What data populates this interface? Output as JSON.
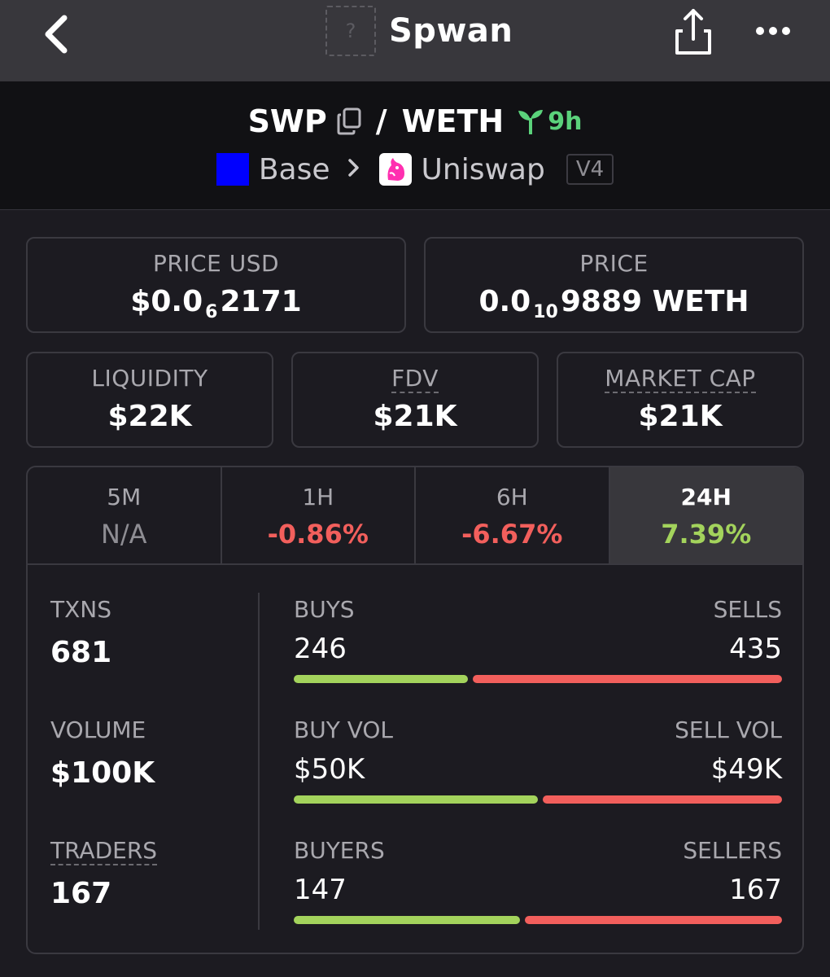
{
  "nav": {
    "title": "Spwan",
    "token_placeholder": "?",
    "icons": {
      "back": "chevron-left-icon",
      "share": "share-icon",
      "more": "more-horizontal-icon"
    }
  },
  "pair": {
    "base": "SWP",
    "separator": "/",
    "quote": "WETH",
    "age": "9h",
    "chain": "Base",
    "chain_color": "#0000ff",
    "dex": "Uniswap",
    "version": "V4"
  },
  "stats": {
    "price_usd": {
      "label": "PRICE USD",
      "prefix": "$0.0",
      "zeros": "6",
      "digits": "2171"
    },
    "price": {
      "label": "PRICE",
      "prefix": "0.0",
      "zeros": "10",
      "digits": "9889 WETH"
    },
    "liquidity": {
      "label": "LIQUIDITY",
      "value": "$22K"
    },
    "fdv": {
      "label": "FDV",
      "value": "$21K"
    },
    "market_cap": {
      "label": "MARKET CAP",
      "value": "$21K"
    }
  },
  "timeframes": [
    {
      "label": "5M",
      "value": "N/A",
      "status": "na"
    },
    {
      "label": "1H",
      "value": "-0.86%",
      "status": "neg"
    },
    {
      "label": "6H",
      "value": "-6.67%",
      "status": "neg"
    },
    {
      "label": "24H",
      "value": "7.39%",
      "status": "pos",
      "active": true
    }
  ],
  "metrics": {
    "txns": {
      "label": "TXNS",
      "value": "681"
    },
    "volume": {
      "label": "VOLUME",
      "value": "$100K"
    },
    "traders": {
      "label": "TRADERS",
      "value": "167"
    }
  },
  "splits": {
    "txns": {
      "left_label": "BUYS",
      "right_label": "SELLS",
      "left_value": "246",
      "right_value": "435",
      "left_fraction": 0.361
    },
    "volume": {
      "left_label": "BUY VOL",
      "right_label": "SELL VOL",
      "left_value": "$50K",
      "right_value": "$49K",
      "left_fraction": 0.505
    },
    "traders": {
      "left_label": "BUYERS",
      "right_label": "SELLERS",
      "left_value": "147",
      "right_value": "167",
      "left_fraction": 0.468
    }
  },
  "colors": {
    "positive": "#a3d35c",
    "negative": "#f25f5c",
    "age_green": "#5bd27b"
  }
}
